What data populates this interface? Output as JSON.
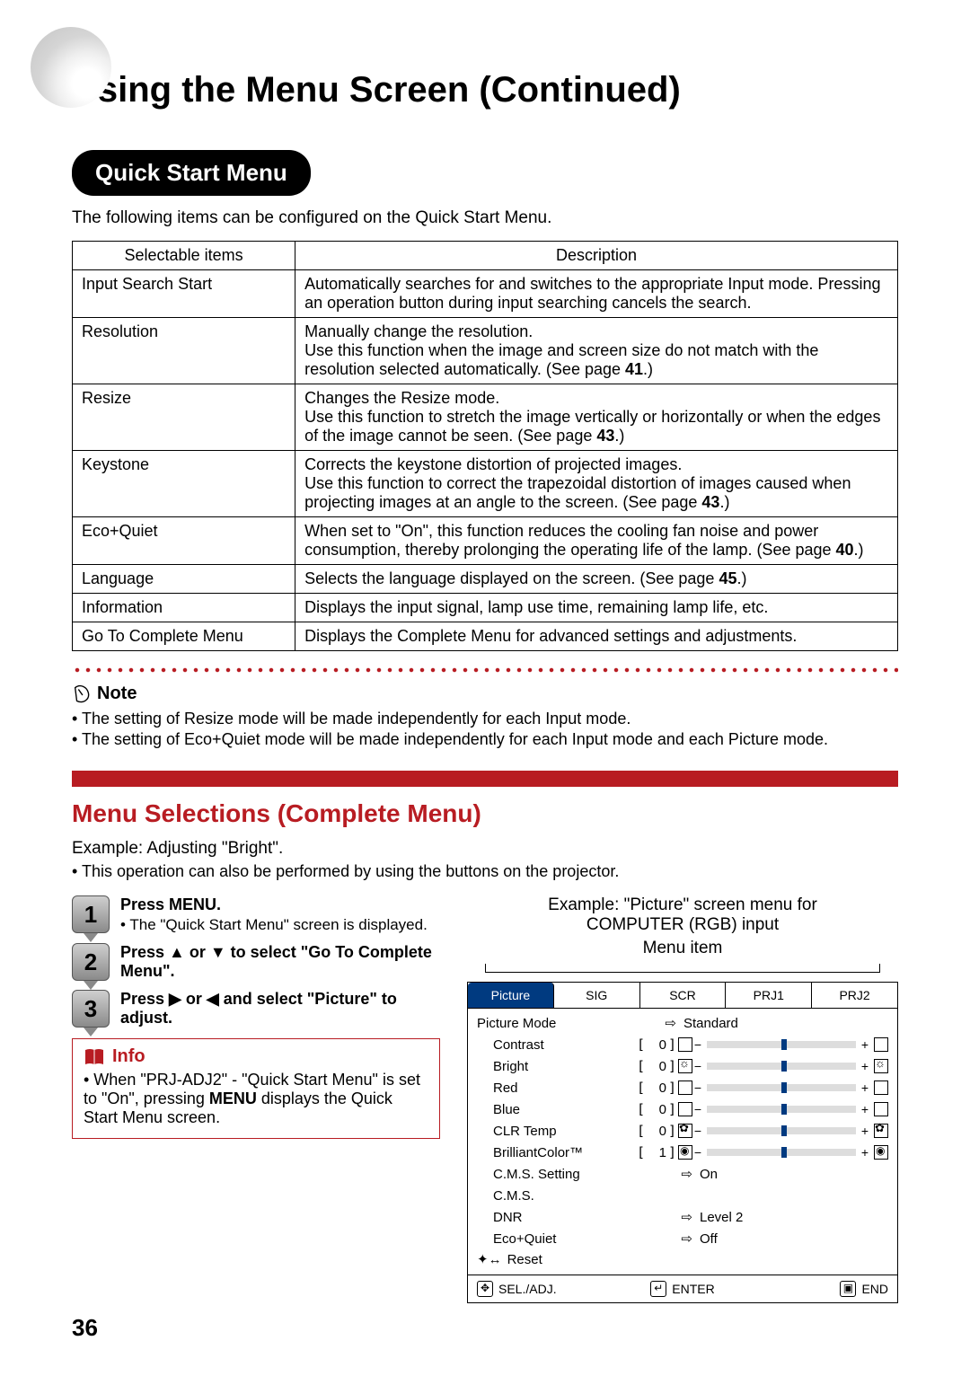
{
  "title": "Using the Menu Screen (Continued)",
  "section": "Quick Start Menu",
  "intro": "The following items can be configured on the Quick Start Menu.",
  "table_headers": {
    "items": "Selectable items",
    "desc": "Description"
  },
  "rows": [
    {
      "item": "Input Search Start",
      "desc": "Automatically searches for and switches to the appropriate Input mode. Pressing an operation button during input searching cancels the search."
    },
    {
      "item": "Resolution",
      "desc": "Manually change the resolution.\nUse this function when the image and screen size do not match with the resolution selected automatically. (See page ",
      "page": "41",
      "tail": ".)"
    },
    {
      "item": "Resize",
      "desc": "Changes the Resize mode.\nUse this function to stretch the image vertically or horizontally or when the edges of the image cannot be seen. (See page ",
      "page": "43",
      "tail": ".)"
    },
    {
      "item": "Keystone",
      "desc": "Corrects the keystone distortion of projected images.\nUse this function to correct the trapezoidal distortion of images caused when projecting images at an angle to the screen. (See page ",
      "page": "43",
      "tail": ".)"
    },
    {
      "item": "Eco+Quiet",
      "desc": "When set to \"On\", this function reduces the cooling fan noise and power consumption, thereby prolonging the operating life of the lamp. (See page ",
      "page": "40",
      "tail": ".)"
    },
    {
      "item": "Language",
      "desc": "Selects the language displayed on the screen. (See page ",
      "page": "45",
      "tail": ".)"
    },
    {
      "item": "Information",
      "desc": "Displays the input signal, lamp use time, remaining lamp life, etc."
    },
    {
      "item": "Go To Complete Menu",
      "desc": "Displays the Complete Menu for advanced settings and adjustments."
    }
  ],
  "note_label": "Note",
  "notes": [
    "The setting of Resize mode will be made independently for each Input mode.",
    "The setting of Eco+Quiet mode will be made independently for each Input mode and each Picture mode."
  ],
  "section2": "Menu Selections (Complete Menu)",
  "example_line": "Example: Adjusting \"Bright\".",
  "example_sub": "• This operation can also be performed by using the buttons on the projector.",
  "steps": [
    {
      "num": "1",
      "title": "Press MENU.",
      "note": "• The \"Quick Start Menu\" screen is displayed."
    },
    {
      "num": "2",
      "title": "Press ▲ or ▼ to select \"Go To Complete Menu\"."
    },
    {
      "num": "3",
      "title": "Press ▶ or ◀ and select \"Picture\" to adjust."
    }
  ],
  "info_label": "Info",
  "info_text": "• When \"PRJ-ADJ2\" - \"Quick Start Menu\" is set to \"On\", pressing MENU displays the Quick Start Menu screen.",
  "info_bold": "MENU",
  "right_caption1": "Example: \"Picture\" screen menu for",
  "right_caption2": "COMPUTER (RGB) input",
  "menu_item_label": "Menu item",
  "osd": {
    "tabs": [
      "Picture",
      "SIG",
      "SCR",
      "PRJ1",
      "PRJ2"
    ],
    "picture_mode_label": "Picture Mode",
    "picture_mode_value": "Standard",
    "sliders": [
      {
        "label": "Contrast",
        "val": "0",
        "icon": ""
      },
      {
        "label": "Bright",
        "val": "0",
        "icon": "sun"
      },
      {
        "label": "Red",
        "val": "0",
        "icon": ""
      },
      {
        "label": "Blue",
        "val": "0",
        "icon": ""
      },
      {
        "label": "CLR Temp",
        "val": "0",
        "icon": "clover"
      },
      {
        "label": "BrilliantColor™",
        "val": "1",
        "icon": "circle"
      }
    ],
    "simple": [
      {
        "label": "C.M.S. Setting",
        "value": "On"
      },
      {
        "label": "C.M.S.",
        "value": ""
      },
      {
        "label": "DNR",
        "value": "Level 2"
      },
      {
        "label": "Eco+Quiet",
        "value": "Off"
      }
    ],
    "reset": "Reset",
    "footer": {
      "sel": "SEL./ADJ.",
      "enter": "ENTER",
      "end": "END"
    }
  },
  "page_number": "36"
}
